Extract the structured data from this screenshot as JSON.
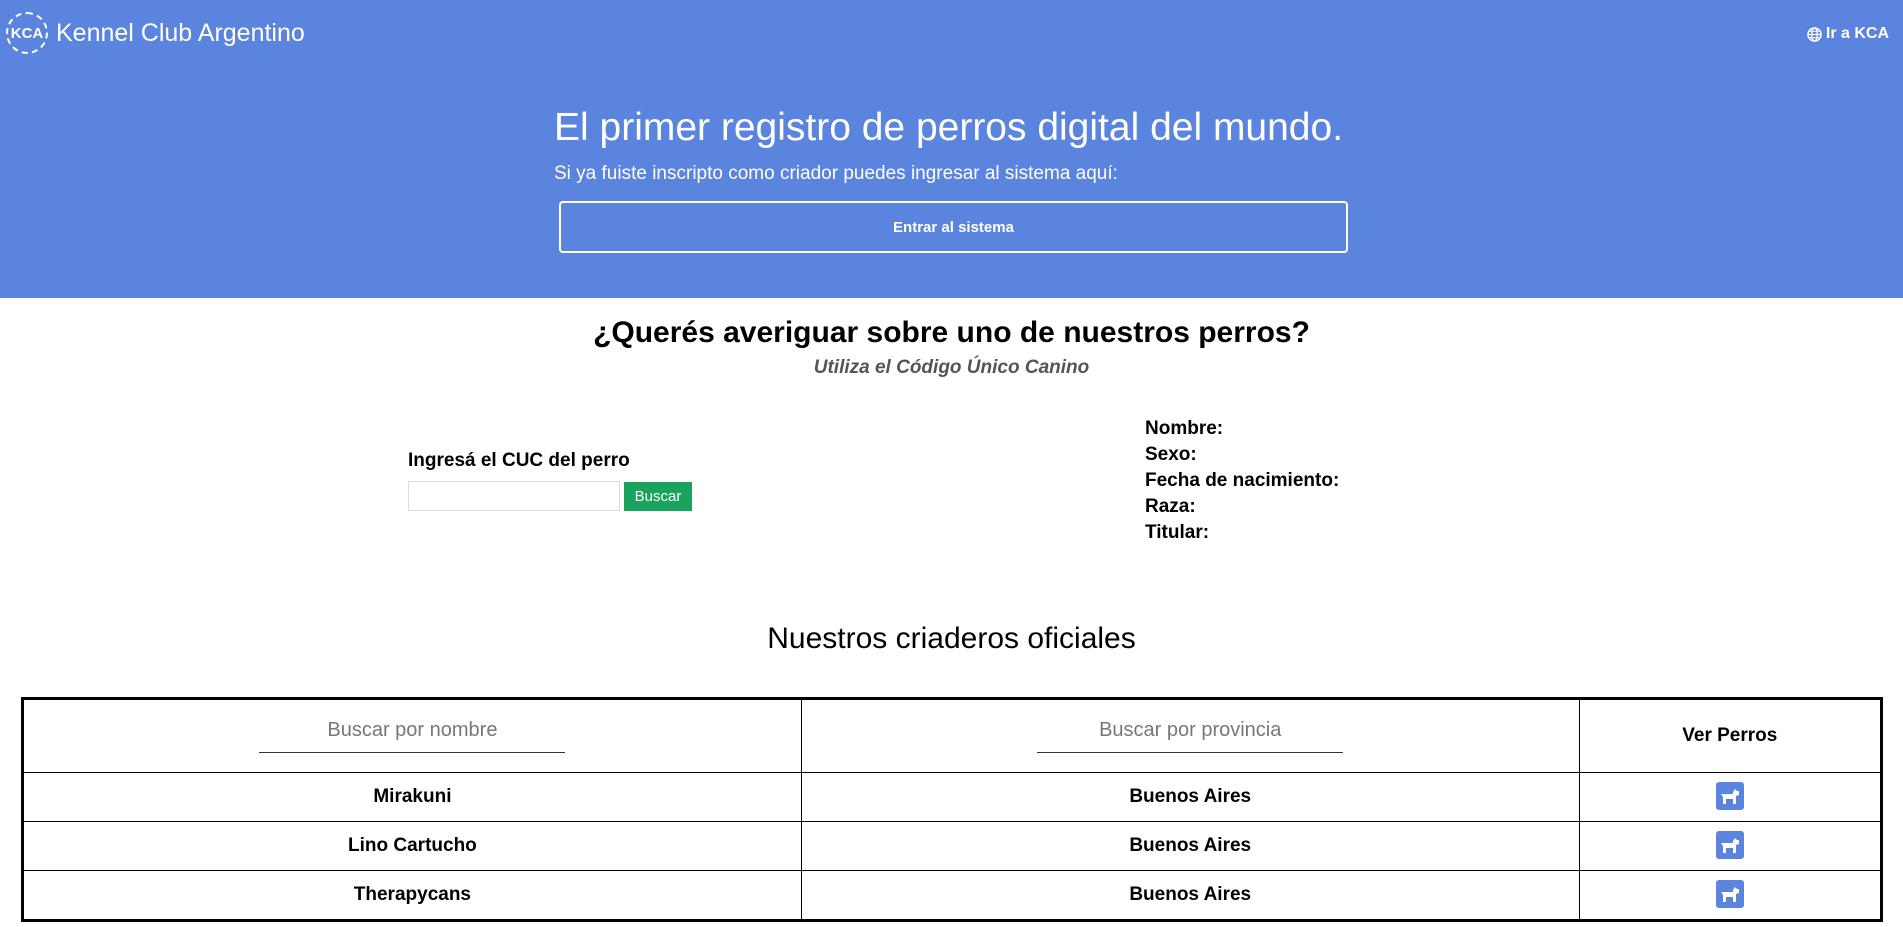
{
  "header": {
    "logo_abbr": "KCA",
    "logo_text": "Kennel Club Argentino",
    "ir_kca_label": "Ir a KCA"
  },
  "hero": {
    "title": "El primer registro de perros digital del mundo.",
    "subtitle": "Si ya fuiste inscripto como criador puedes ingresar al sistema aquí:",
    "enter_button": "Entrar al sistema"
  },
  "lookup": {
    "title": "¿Querés averiguar sobre uno de nuestros perros?",
    "subtitle": "Utiliza el Código Único Canino",
    "cuc_label": "Ingresá el CUC del perro",
    "cuc_value": "",
    "search_button": "Buscar",
    "fields": [
      "Nombre:",
      "Sexo:",
      "Fecha de nacimiento:",
      "Raza:",
      "Titular:"
    ]
  },
  "criaderos": {
    "title": "Nuestros criaderos oficiales",
    "search_name_placeholder": "Buscar por nombre",
    "search_province_placeholder": "Buscar por provincia",
    "ver_perros_header": "Ver Perros",
    "rows": [
      {
        "name": "Mirakuni",
        "province": "Buenos Aires"
      },
      {
        "name": "Lino Cartucho",
        "province": "Buenos Aires"
      },
      {
        "name": "Therapycans",
        "province": "Buenos Aires"
      }
    ],
    "row_icon": "dog-icon"
  },
  "colors": {
    "hero_bg": "#5b84de",
    "search_button_bg": "#19a35e"
  }
}
